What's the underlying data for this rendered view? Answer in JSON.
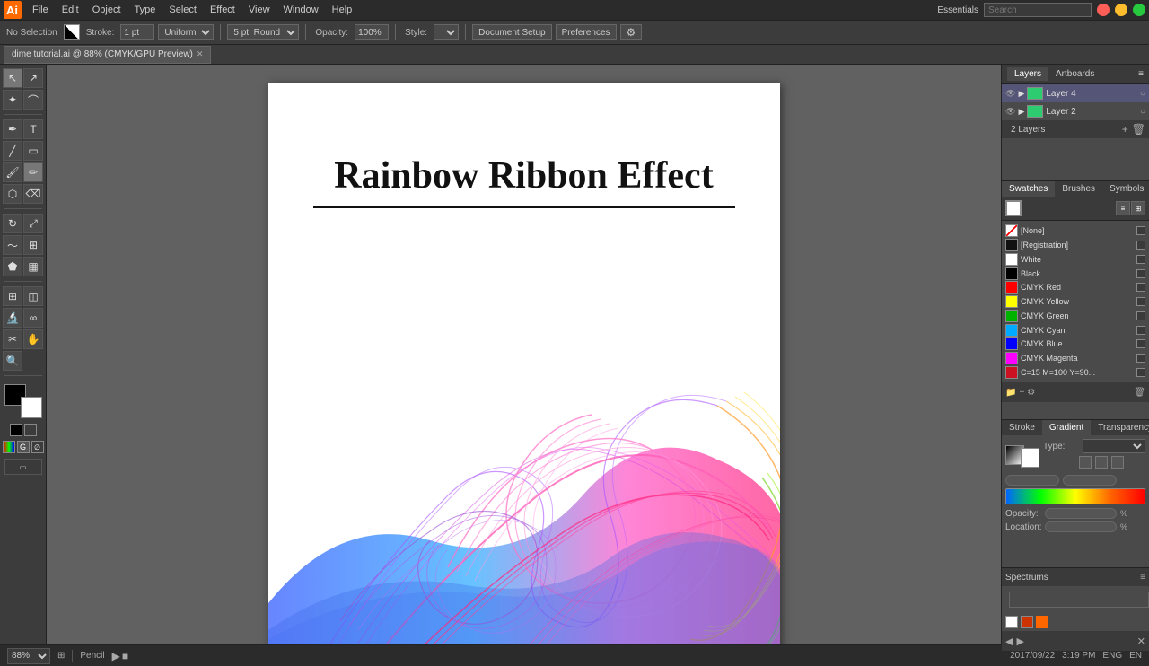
{
  "app": {
    "title": "Adobe Illustrator",
    "workspace": "Essentials"
  },
  "menubar": {
    "items": [
      "Ai",
      "File",
      "Edit",
      "Object",
      "Type",
      "Select",
      "Effect",
      "View",
      "Window",
      "Help"
    ],
    "search_placeholder": "Search"
  },
  "toolbar": {
    "selection": "No Selection",
    "stroke_label": "Stroke:",
    "stroke_value": "1 pt",
    "stroke_type": "Uniform",
    "weight": "5 pt. Round",
    "opacity_label": "Opacity:",
    "opacity_value": "100%",
    "style_label": "Style:",
    "document_setup": "Document Setup",
    "preferences": "Preferences"
  },
  "document": {
    "tab_name": "dime tutorial.ai @ 88% (CMYK/GPU Preview)"
  },
  "artboard": {
    "title": "Rainbow Ribbon Effect",
    "zoom": "88%"
  },
  "layers_panel": {
    "tabs": [
      "Layers",
      "Artboards"
    ],
    "layers": [
      {
        "name": "Layer 4",
        "visible": true,
        "locked": false,
        "color": "#2ecc71"
      },
      {
        "name": "Layer 2",
        "visible": true,
        "locked": false,
        "color": "#2ecc71"
      }
    ],
    "count": "2 Layers"
  },
  "swatches_panel": {
    "tabs": [
      "Swatches",
      "Brushes",
      "Symbols"
    ],
    "items": [
      {
        "name": "[None]",
        "color": "transparent",
        "bordered": true
      },
      {
        "name": "[Registration]",
        "color": "#111111"
      },
      {
        "name": "White",
        "color": "#ffffff"
      },
      {
        "name": "Black",
        "color": "#000000"
      },
      {
        "name": "CMYK Red",
        "color": "#ff0000"
      },
      {
        "name": "CMYK Yellow",
        "color": "#ffff00"
      },
      {
        "name": "CMYK Green",
        "color": "#00b300"
      },
      {
        "name": "CMYK Cyan",
        "color": "#00aaff"
      },
      {
        "name": "CMYK Blue",
        "color": "#0000ff"
      },
      {
        "name": "CMYK Magenta",
        "color": "#ff00ff"
      },
      {
        "name": "C=15 M=100 Y=90...",
        "color": "#cc1122"
      }
    ]
  },
  "gradient_panel": {
    "tabs": [
      "Stroke",
      "Gradient",
      "Transparency"
    ],
    "type_label": "Type:",
    "type_value": "",
    "stroke_label": "Stroke:",
    "opacity_label": "Opacity:",
    "location_label": "Location:"
  },
  "spectrums_panel": {
    "title": "Spectrums",
    "search_placeholder": ""
  },
  "status_bar": {
    "tool": "Pencil",
    "zoom": "88%"
  },
  "tools": {
    "list": [
      "↖",
      "↗",
      "✏",
      "⬡",
      "T",
      "✒",
      "🖊",
      "◯",
      "▭",
      "⬟",
      "⭐",
      "✂",
      "🔍",
      "🖐"
    ]
  },
  "colors": {
    "fg": "#000000",
    "bg": "#ffffff",
    "accent": "#555599",
    "ribbon_gradient": [
      "#0033ff",
      "#00aaff",
      "#ff66aa",
      "#ff00aa",
      "#ff6600",
      "#ffff00",
      "#00cc00"
    ]
  }
}
